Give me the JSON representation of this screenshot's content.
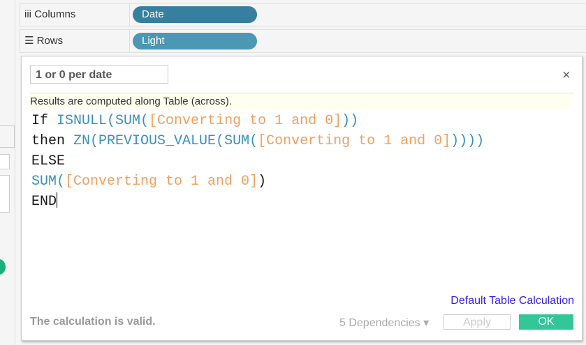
{
  "shelves": {
    "columns_label": "Columns",
    "columns_pill": "Date",
    "rows_label": "Rows",
    "rows_pill": "Light",
    "columns_icon": "iii",
    "rows_icon": "☰"
  },
  "colors": {
    "columns_pill": "#367f9e",
    "rows_pill": "#4b97b4",
    "ok": "#33c797",
    "link": "#3322dd"
  },
  "dialog": {
    "calc_name": "1 or 0 per date",
    "close": "×",
    "info": "Results are computed along Table (across).",
    "code": {
      "l1": {
        "kw": "If ",
        "fn1": "ISNULL(",
        "fn2": "SUM(",
        "fld": "[Converting to 1 and 0]",
        "end": "))"
      },
      "l2": {
        "kw": "then ",
        "fn1": "ZN(",
        "fn2": "PREVIOUS_VALUE(",
        "fn3": "SUM(",
        "fld": "[Converting to 1 and 0]",
        "end": "))))"
      },
      "l3": "ELSE",
      "l4": {
        "fn": "SUM(",
        "fld": "[Converting to 1 and 0]",
        "end": ")"
      },
      "l5": "END"
    },
    "default_table_calc": "Default Table Calculation",
    "status": "The calculation is valid.",
    "dependencies": "5 Dependencies ▾",
    "apply": "Apply",
    "ok": "OK"
  }
}
